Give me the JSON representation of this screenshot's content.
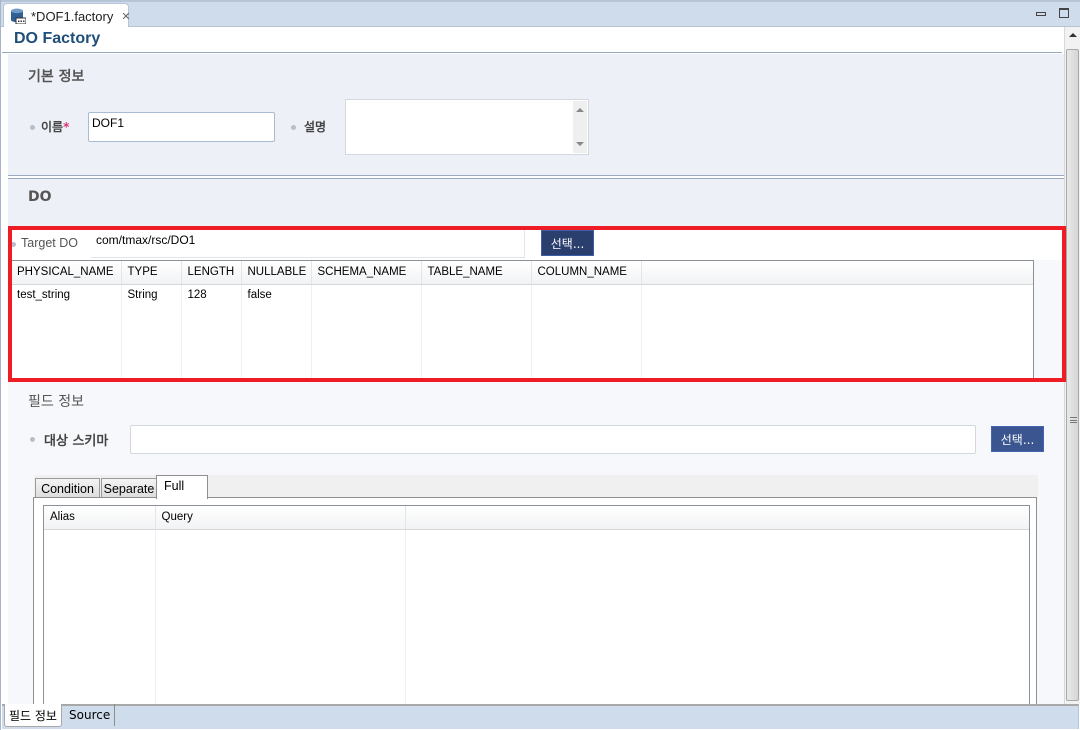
{
  "editor": {
    "tab_title": "*DOF1.factory",
    "tab_icon": "database-icon",
    "close_glyph": "✕"
  },
  "header": {
    "title": "DO Factory"
  },
  "basic_info": {
    "section_title": "기본 정보",
    "name_label": "이름",
    "required_mark": "*",
    "name_value": "DOF1",
    "description_label": "설명",
    "description_value": ""
  },
  "do_section": {
    "section_title": "DO",
    "target_label": "Target DO",
    "target_value": "com/tmax/rsc/DO1",
    "select_button": "선택...",
    "columns": [
      "PHYSICAL_NAME",
      "TYPE",
      "LENGTH",
      "NULLABLE",
      "SCHEMA_NAME",
      "TABLE_NAME",
      "COLUMN_NAME",
      ""
    ],
    "rows": [
      [
        "test_string",
        "String",
        "128",
        "false",
        "",
        "",
        "",
        ""
      ]
    ]
  },
  "field_info": {
    "section_title": "필드 정보",
    "schema_label": "대상 스키마",
    "schema_value": "",
    "select_button": "선택...",
    "tabs": [
      {
        "label": "Condition",
        "active": false
      },
      {
        "label": "Separate",
        "active": false
      },
      {
        "label": "Full",
        "active": true
      }
    ],
    "columns": [
      "Alias",
      "Query",
      ""
    ],
    "rows": []
  },
  "bottom_tabs": [
    {
      "label": "필드 정보",
      "active": true
    },
    {
      "label": "Source",
      "active": false
    }
  ],
  "colors": {
    "highlight": "#ee1c25",
    "button_bg": "#2a3f6e",
    "header_title": "#1f4e79",
    "tab_bar": "#cfdcec",
    "section_bg": "#edf0f7"
  }
}
